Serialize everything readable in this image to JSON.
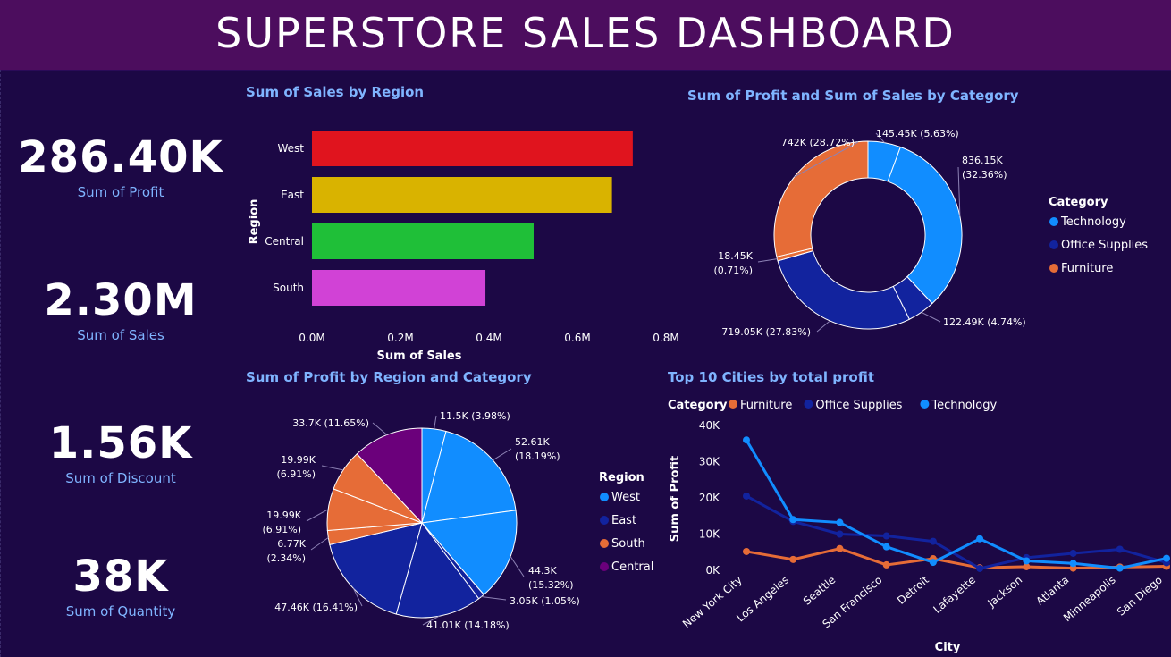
{
  "header": {
    "title": "SUPERSTORE SALES DASHBOARD"
  },
  "kpis": [
    {
      "value": "286.40K",
      "label": "Sum of Profit"
    },
    {
      "value": "2.30M",
      "label": "Sum of Sales"
    },
    {
      "value": "1.56K",
      "label": "Sum of Discount"
    },
    {
      "value": "38K",
      "label": "Sum of Quantity"
    }
  ],
  "colors": {
    "background": "#1c0845",
    "header": "#4c0d5e",
    "accent": "#7fb4ff",
    "technology": "#118dff",
    "office_supplies": "#12239e",
    "furniture": "#e66c37",
    "central": "#6b007b"
  },
  "chart_data": [
    {
      "id": "sales_by_region",
      "type": "bar",
      "orientation": "horizontal",
      "title": "Sum of Sales by Region",
      "xlabel": "Sum of Sales",
      "ylabel": "Region",
      "categories": [
        "West",
        "East",
        "Central",
        "South"
      ],
      "values": [
        0.725,
        0.678,
        0.501,
        0.392
      ],
      "colors": [
        "#e0141e",
        "#d9b300",
        "#1fbf38",
        "#d142d6"
      ],
      "xlim": [
        0,
        0.8
      ],
      "xticks": [
        "0.0M",
        "0.2M",
        "0.4M",
        "0.6M",
        "0.8M"
      ],
      "grid": false
    },
    {
      "id": "profit_sales_by_category",
      "type": "pie",
      "variant": "donut",
      "title": "Sum of Profit and Sum of Sales by Category",
      "legend_title": "Category",
      "legend_position": "right",
      "legend": [
        {
          "name": "Technology",
          "color": "#118dff"
        },
        {
          "name": "Office Supplies",
          "color": "#12239e"
        },
        {
          "name": "Furniture",
          "color": "#e66c37"
        }
      ],
      "slices": [
        {
          "label": "145.45K (5.63%)",
          "value": 145.45,
          "percent": 5.63,
          "color": "#118dff"
        },
        {
          "label": "836.15K (32.36%)",
          "value": 836.15,
          "percent": 32.36,
          "color": "#118dff"
        },
        {
          "label": "122.49K (4.74%)",
          "value": 122.49,
          "percent": 4.74,
          "color": "#12239e"
        },
        {
          "label": "719.05K (27.83%)",
          "value": 719.05,
          "percent": 27.83,
          "color": "#12239e"
        },
        {
          "label": "18.45K (0.71%)",
          "value": 18.45,
          "percent": 0.71,
          "color": "#e66c37"
        },
        {
          "label": "742K (28.72%)",
          "value": 742,
          "percent": 28.72,
          "color": "#e66c37"
        }
      ]
    },
    {
      "id": "profit_by_region_category",
      "type": "pie",
      "title": "Sum of Profit by Region and Category",
      "legend_title": "Region",
      "legend_position": "right",
      "legend": [
        {
          "name": "West",
          "color": "#118dff"
        },
        {
          "name": "East",
          "color": "#12239e"
        },
        {
          "name": "South",
          "color": "#e66c37"
        },
        {
          "name": "Central",
          "color": "#6b007b"
        }
      ],
      "slices": [
        {
          "label": "11.5K (3.98%)",
          "value": 11.5,
          "percent": 3.98,
          "color": "#118dff"
        },
        {
          "label": "52.61K (18.19%)",
          "value": 52.61,
          "percent": 18.19,
          "color": "#118dff"
        },
        {
          "label": "44.3K (15.32%)",
          "value": 44.3,
          "percent": 15.32,
          "color": "#118dff"
        },
        {
          "label": "3.05K (1.05%)",
          "value": 3.05,
          "percent": 1.05,
          "color": "#12239e"
        },
        {
          "label": "41.01K (14.18%)",
          "value": 41.01,
          "percent": 14.18,
          "color": "#12239e"
        },
        {
          "label": "47.46K (16.41%)",
          "value": 47.46,
          "percent": 16.41,
          "color": "#12239e"
        },
        {
          "label": "6.77K (2.34%)",
          "value": 6.77,
          "percent": 2.34,
          "color": "#e66c37"
        },
        {
          "label": "19.99K (6.91%)",
          "value": 19.99,
          "percent": 6.91,
          "color": "#e66c37"
        },
        {
          "label": "19.99K (6.91%)",
          "value": 19.99,
          "percent": 6.91,
          "color": "#e66c37"
        },
        {
          "label": "33.7K (11.65%)",
          "value": 33.7,
          "percent": 11.65,
          "color": "#6b007b"
        }
      ]
    },
    {
      "id": "top10_cities_profit",
      "type": "line",
      "title": "Top 10 Cities by total profit",
      "legend_title": "Category",
      "legend_position": "top-left",
      "xlabel": "City",
      "ylabel": "Sum of Profit",
      "categories": [
        "New York City",
        "Los Angeles",
        "Seattle",
        "San Francisco",
        "Detroit",
        "Lafayette",
        "Jackson",
        "Atlanta",
        "Minneapolis",
        "San Diego"
      ],
      "ylim": [
        0,
        40000
      ],
      "yticks": [
        "0K",
        "10K",
        "20K",
        "30K",
        "40K"
      ],
      "grid": false,
      "series": [
        {
          "name": "Furniture",
          "color": "#e66c37",
          "values": [
            5200,
            3000,
            6000,
            1500,
            3200,
            700,
            1000,
            600,
            900,
            1100
          ]
        },
        {
          "name": "Office Supplies",
          "color": "#12239e",
          "values": [
            20500,
            13500,
            10000,
            9500,
            8000,
            500,
            3500,
            4700,
            5800,
            2100
          ]
        },
        {
          "name": "Technology",
          "color": "#118dff",
          "values": [
            36000,
            14000,
            13200,
            6500,
            2200,
            8700,
            2600,
            1900,
            600,
            3300
          ]
        }
      ]
    }
  ]
}
